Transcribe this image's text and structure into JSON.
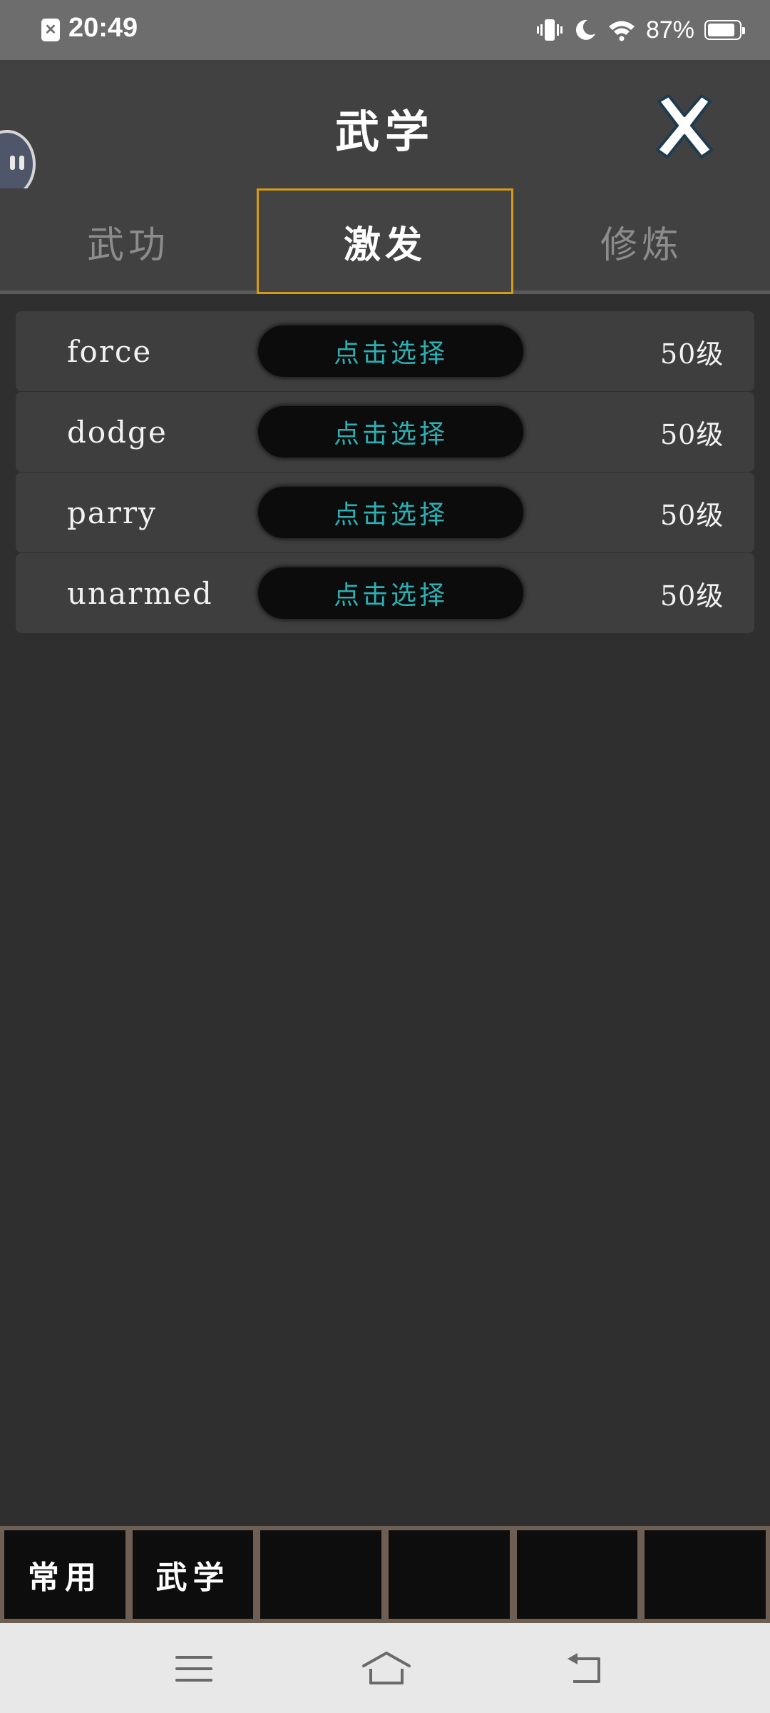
{
  "status_bar": {
    "time": "20:49",
    "battery_percent": "87%",
    "battery_level": 0.87,
    "icons": [
      "sim-off-icon",
      "vibrate-icon",
      "moon-icon",
      "wifi-icon",
      "battery-icon"
    ]
  },
  "header": {
    "title": "武学",
    "close_icon": "close-icon"
  },
  "tabs": [
    {
      "label": "武功",
      "active": false
    },
    {
      "label": "激发",
      "active": true
    },
    {
      "label": "修炼",
      "active": false
    }
  ],
  "skills": [
    {
      "name": "force",
      "select_label": "点击选择",
      "level": "50级"
    },
    {
      "name": "dodge",
      "select_label": "点击选择",
      "level": "50级"
    },
    {
      "name": "parry",
      "select_label": "点击选择",
      "level": "50级"
    },
    {
      "name": "unarmed",
      "select_label": "点击选择",
      "level": "50级"
    }
  ],
  "bottom_bar": {
    "slots": [
      "常用",
      "武学",
      "",
      "",
      "",
      ""
    ]
  },
  "nav_bar": {
    "icons": [
      "menu-icon",
      "home-icon",
      "back-icon"
    ]
  },
  "colors": {
    "accent_tab_border": "#d69a16",
    "select_text": "#2bb0b3",
    "background": "#2f2f2f",
    "header": "#414141"
  }
}
